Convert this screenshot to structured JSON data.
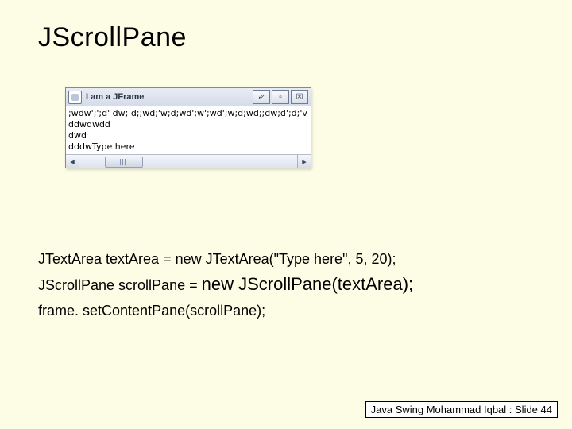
{
  "title": "JScrollPane",
  "frame": {
    "title": "I am a JFrame",
    "lines": [
      ";wdw';';d' dw; d;;wd;'w;d;wd';w';wd';w;d;wd;;dw;d';d;'v",
      "ddwdwdd",
      "dwd",
      "dddwType here"
    ],
    "minimize": "⇙",
    "maximize": "▫",
    "close": "☒",
    "left": "◂",
    "right": "▸"
  },
  "code": {
    "l1": "JTextArea textArea = new JTextArea(\"Type here\", 5, 20);",
    "l2a": "JScrollPane scrollPane = ",
    "l2b": "new JScrollPane(textArea);",
    "l3": "frame. setContentPane(scrollPane);"
  },
  "footer": "Java Swing Mohammad Iqbal : Slide 44"
}
